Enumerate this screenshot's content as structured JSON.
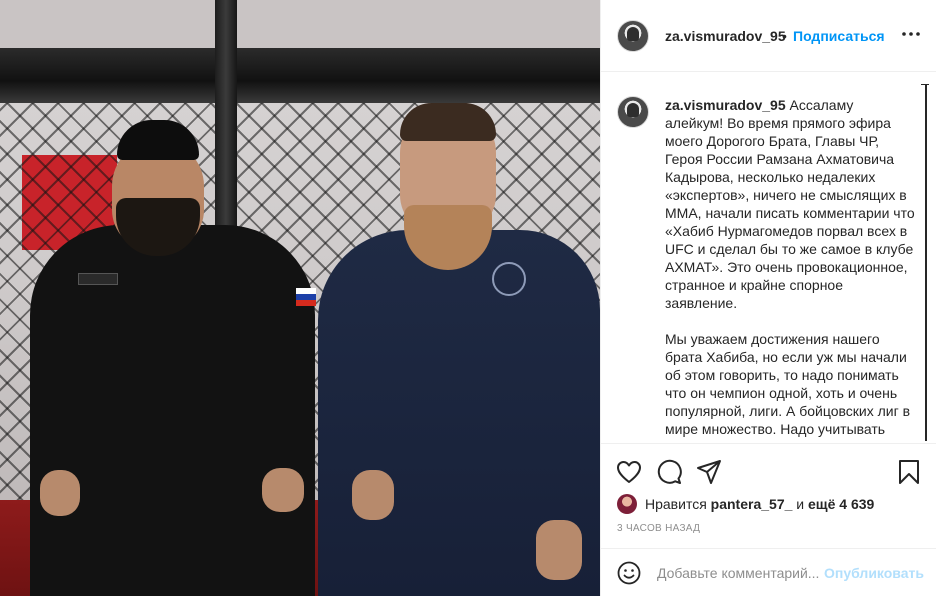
{
  "photo": {
    "alt_description_icon": "post-photo"
  },
  "header": {
    "username": "za.vismuradov_95",
    "separator": "•",
    "follow_label": "Подписаться",
    "more_label": "•••"
  },
  "caption": {
    "username": "za.vismuradov_95",
    "text": "Ассаламу алейкум! Во время прямого эфира моего Дорогого Брата, Главы ЧР, Героя России Рамзана Ахматовича Кадырова, несколько недалеких «экспертов», ничего не смыслящих в ММА, начали писать комментарии что «Хабиб Нурмагомедов порвал всех в UFC и сделал бы то же самое в клубе АХМАТ». Это очень провокационное, странное и крайне спорное заявление.\n\nМы уважаем достижения нашего брата Хабиба, но если уж мы начали об этом говорить, то надо понимать что он чемпион одной, хоть и очень популярной, лиги. А бойцовских лиг в мире множество. Надо учитывать"
  },
  "actions": {
    "like_icon": "heart-icon",
    "comment_icon": "comment-icon",
    "share_icon": "paper-plane-icon",
    "save_icon": "bookmark-icon"
  },
  "likes": {
    "prefix": "Нравится ",
    "user": "pantera_57_",
    "middle": " и ",
    "count": "ещё 4 639"
  },
  "time": "3 часов назад",
  "comment_box": {
    "placeholder": "Добавьте комментарий...",
    "publish_label": "Опубликовать"
  },
  "colors": {
    "accent": "#0095f6",
    "publish_disabled": "#b2dffc",
    "secondary_text": "#8e8e8e"
  }
}
